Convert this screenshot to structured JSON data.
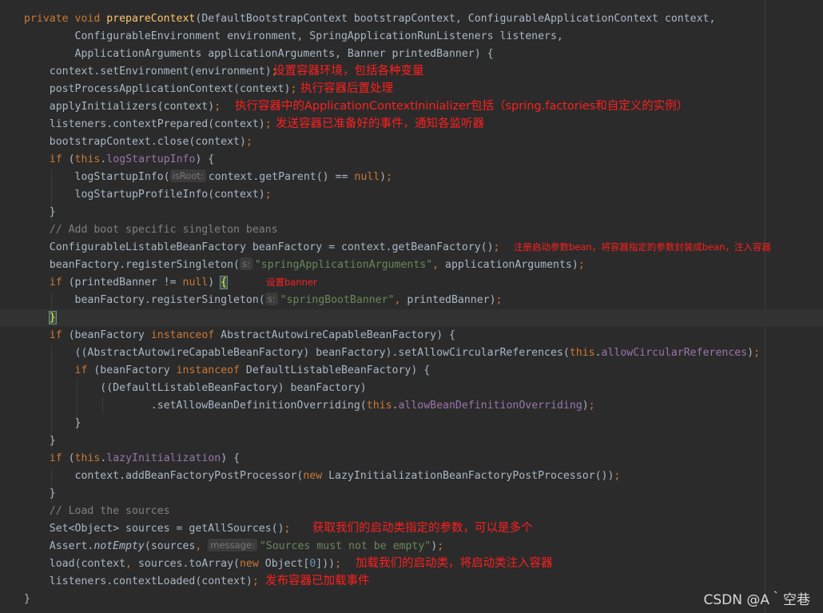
{
  "editor": {
    "lines": [
      [
        [
          "kw",
          "private void "
        ],
        [
          "fn",
          "prepareContext"
        ],
        [
          "t",
          "(DefaultBootstrapContext bootstrapContext, ConfigurableApplicationContext context,"
        ]
      ],
      [
        [
          "t",
          "        ConfigurableEnvironment environment, SpringApplicationRunListeners listeners,"
        ]
      ],
      [
        [
          "t",
          "        ApplicationArguments applicationArguments, Banner printedBanner) {"
        ]
      ],
      [
        [
          "t",
          "    context.setEnvironment(environment)"
        ],
        [
          "kw",
          ";"
        ]
      ],
      [
        [
          "t",
          "    postProcessApplicationContext(context)"
        ],
        [
          "kw",
          ";"
        ]
      ],
      [
        [
          "t",
          "    applyInitializers(context)"
        ],
        [
          "kw",
          ";"
        ]
      ],
      [
        [
          "t",
          "    listeners.contextPrepared(context)"
        ],
        [
          "kw",
          ";"
        ]
      ],
      [
        [
          "t",
          "    bootstrapContext.close(context)"
        ],
        [
          "kw",
          ";"
        ]
      ],
      [
        [
          "t",
          "    "
        ],
        [
          "kw",
          "if "
        ],
        [
          "t",
          "("
        ],
        [
          "kw",
          "this"
        ],
        [
          "t",
          "."
        ],
        [
          "field",
          "logStartupInfo"
        ],
        [
          "t",
          ") {"
        ]
      ],
      [
        [
          "t",
          "        logStartupInfo("
        ],
        [
          "hint",
          "isRoot:"
        ],
        [
          "t",
          "context.getParent() == "
        ],
        [
          "kw",
          "null"
        ],
        [
          "t",
          ")"
        ],
        [
          "kw",
          ";"
        ]
      ],
      [
        [
          "t",
          "        logStartupProfileInfo(context)"
        ],
        [
          "kw",
          ";"
        ]
      ],
      [
        [
          "t",
          "    }"
        ]
      ],
      [
        [
          "cm",
          "    // Add boot specific singleton beans"
        ]
      ],
      [
        [
          "t",
          "    ConfigurableListableBeanFactory beanFactory = context.getBeanFactory()"
        ],
        [
          "kw",
          ";"
        ]
      ],
      [
        [
          "t",
          "    beanFactory.registerSingleton("
        ],
        [
          "hint",
          "s:"
        ],
        [
          "str",
          "\"springApplicationArguments\""
        ],
        [
          "kw",
          ", "
        ],
        [
          "t",
          "applicationArguments)"
        ],
        [
          "kw",
          ";"
        ]
      ],
      [
        [
          "t",
          "    "
        ],
        [
          "kw",
          "if "
        ],
        [
          "t",
          "(printedBanner != "
        ],
        [
          "kw",
          "null"
        ],
        [
          "t",
          ") "
        ],
        [
          "bh",
          "{"
        ]
      ],
      [
        [
          "t",
          "        beanFactory.registerSingleton("
        ],
        [
          "hint",
          "s:"
        ],
        [
          "str",
          "\"springBootBanner\""
        ],
        [
          "kw",
          ", "
        ],
        [
          "t",
          "printedBanner)"
        ],
        [
          "kw",
          ";"
        ]
      ],
      [
        [
          "t",
          "    "
        ],
        [
          "bh",
          "}"
        ]
      ],
      [
        [
          "t",
          "    "
        ],
        [
          "kw",
          "if "
        ],
        [
          "t",
          "(beanFactory "
        ],
        [
          "kw",
          "instanceof "
        ],
        [
          "t",
          "AbstractAutowireCapableBeanFactory) {"
        ]
      ],
      [
        [
          "t",
          "        ((AbstractAutowireCapableBeanFactory) beanFactory).setAllowCircularReferences("
        ],
        [
          "kw",
          "this"
        ],
        [
          "t",
          "."
        ],
        [
          "field",
          "allowCircularReferences"
        ],
        [
          "t",
          ")"
        ],
        [
          "kw",
          ";"
        ]
      ],
      [
        [
          "t",
          "        "
        ],
        [
          "kw",
          "if "
        ],
        [
          "t",
          "(beanFactory "
        ],
        [
          "kw",
          "instanceof "
        ],
        [
          "t",
          "DefaultListableBeanFactory) {"
        ]
      ],
      [
        [
          "t",
          "            ((DefaultListableBeanFactory) beanFactory)"
        ]
      ],
      [
        [
          "t",
          "                    .setAllowBeanDefinitionOverriding("
        ],
        [
          "kw",
          "this"
        ],
        [
          "t",
          "."
        ],
        [
          "field",
          "allowBeanDefinitionOverriding"
        ],
        [
          "t",
          ")"
        ],
        [
          "kw",
          ";"
        ]
      ],
      [
        [
          "t",
          "        }"
        ]
      ],
      [
        [
          "t",
          "    }"
        ]
      ],
      [
        [
          "t",
          "    "
        ],
        [
          "kw",
          "if "
        ],
        [
          "t",
          "("
        ],
        [
          "kw",
          "this"
        ],
        [
          "t",
          "."
        ],
        [
          "field",
          "lazyInitialization"
        ],
        [
          "t",
          ") {"
        ]
      ],
      [
        [
          "t",
          "        context.addBeanFactoryPostProcessor("
        ],
        [
          "kw",
          "new "
        ],
        [
          "t",
          "LazyInitializationBeanFactoryPostProcessor())"
        ],
        [
          "kw",
          ";"
        ]
      ],
      [
        [
          "t",
          "    }"
        ]
      ],
      [
        [
          "cm",
          "    // Load the sources"
        ]
      ],
      [
        [
          "t",
          "    Set<Object> sources = getAllSources()"
        ],
        [
          "kw",
          ";"
        ]
      ],
      [
        [
          "t",
          "    Assert."
        ],
        [
          "ital",
          "notEmpty"
        ],
        [
          "t",
          "(sources"
        ],
        [
          "kw",
          ", "
        ],
        [
          "hint",
          "message:"
        ],
        [
          "str",
          "\"Sources must not be empty\""
        ],
        [
          "t",
          ")"
        ],
        [
          "kw",
          ";"
        ]
      ],
      [
        [
          "t",
          "    load(context"
        ],
        [
          "kw",
          ", "
        ],
        [
          "t",
          "sources.toArray("
        ],
        [
          "kw",
          "new "
        ],
        [
          "t",
          "Object["
        ],
        [
          "num",
          "0"
        ],
        [
          "t",
          "]))"
        ],
        [
          "kw",
          ";"
        ]
      ],
      [
        [
          "t",
          "    listeners.contextLoaded(context)"
        ],
        [
          "kw",
          ";"
        ]
      ],
      [
        [
          "t",
          "}"
        ]
      ]
    ],
    "current_line": 17
  },
  "annotations": [
    {
      "line": 3,
      "text": "设置容器环境，包括各种变量"
    },
    {
      "line": 4,
      "text": "执行容器后置处理"
    },
    {
      "line": 5,
      "text": "执行容器中的ApplicationContextIninializer包括（spring.factories和自定义的实例）"
    },
    {
      "line": 6,
      "text": "发送容器已准备好的事件，通知各监听器"
    },
    {
      "line": 13,
      "text": "注册启动参数bean，将容器指定的参数封装成bean，注入容器"
    },
    {
      "line": 15,
      "text": "设置banner"
    },
    {
      "line": 29,
      "text": "获取我们的启动类指定的参数，可以是多个"
    },
    {
      "line": 31,
      "text": "加载我们的启动类，将启动类注入容器"
    },
    {
      "line": 32,
      "text": "发布容器已加载事件"
    }
  ],
  "watermark": "CSDN @A｀空巷",
  "colors": {
    "background": "#2b2b2b",
    "keyword": "#cc7832",
    "method_declaration": "#ffc66d",
    "string": "#6a8759",
    "field": "#9876aa",
    "comment": "#808080",
    "number": "#6897bb",
    "annotation_red": "#ff1f1f"
  }
}
